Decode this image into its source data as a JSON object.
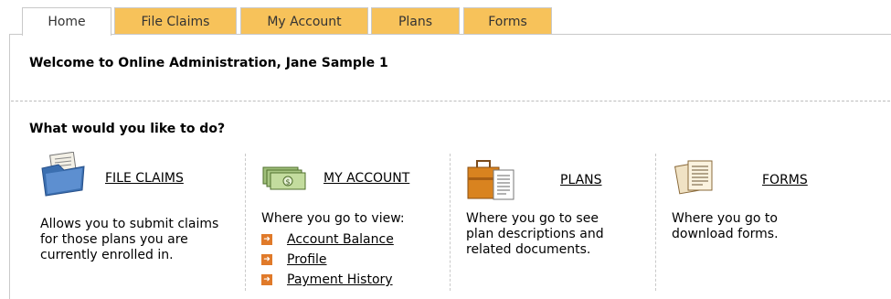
{
  "tabs": [
    {
      "label": "Home",
      "active": true
    },
    {
      "label": "File Claims",
      "active": false
    },
    {
      "label": "My Account",
      "active": false
    },
    {
      "label": "Plans",
      "active": false
    },
    {
      "label": "Forms",
      "active": false
    }
  ],
  "welcome": "Welcome to Online Administration, Jane Sample 1",
  "question": "What would you like to do?",
  "sections": {
    "file_claims": {
      "title": "FILE CLAIMS",
      "description_lines": [
        "Allows you to submit claims",
        "for those plans you are",
        "currently enrolled in."
      ],
      "icon": "folder-icon"
    },
    "my_account": {
      "title": "MY ACCOUNT",
      "description": "Where you go to view:",
      "icon": "money-icon",
      "links": [
        "Account Balance",
        "Profile",
        "Payment History"
      ]
    },
    "plans": {
      "title": "PLANS",
      "description_lines": [
        "Where you go to see",
        "plan descriptions and",
        "related documents."
      ],
      "icon": "briefcase-icon"
    },
    "forms": {
      "title": "FORMS",
      "description_lines": [
        "Where you go to",
        "download forms."
      ],
      "icon": "documents-icon"
    }
  },
  "colors": {
    "tab_inactive": "#f7c25a",
    "bullet": "#e07a2a"
  }
}
